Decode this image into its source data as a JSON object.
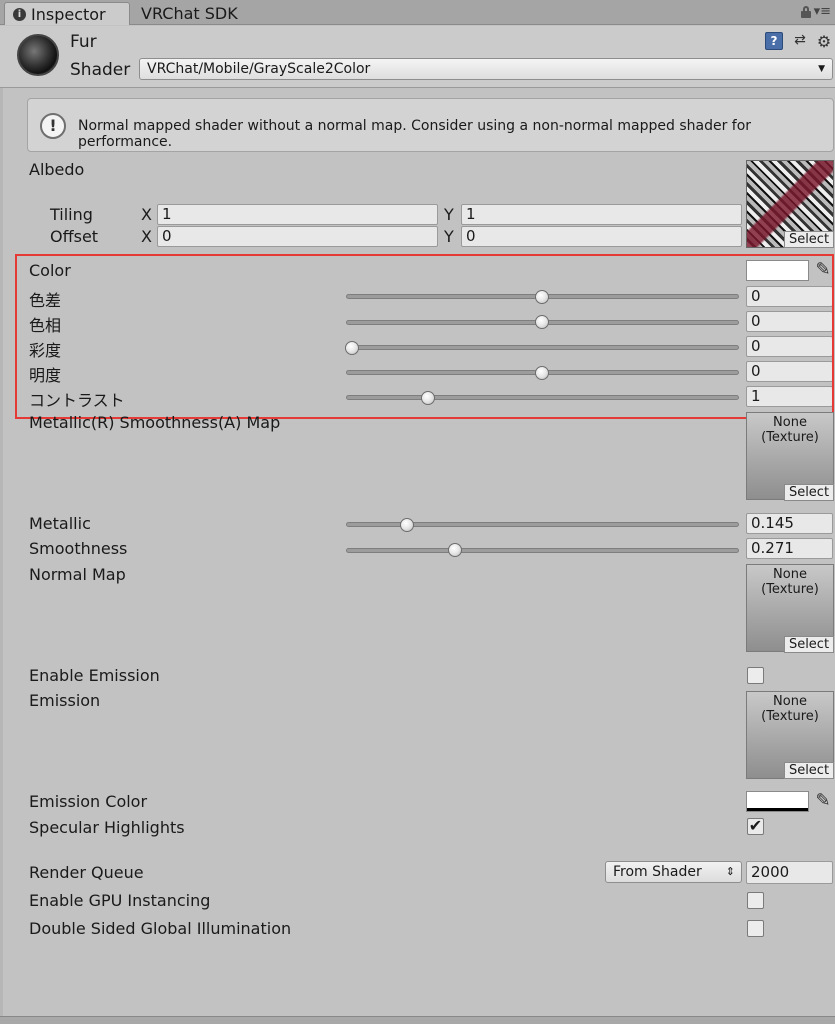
{
  "tabs": [
    {
      "label": "Inspector",
      "active": true,
      "icon": "info-icon"
    },
    {
      "label": "VRChat SDK",
      "active": false
    }
  ],
  "header": {
    "material_name": "Fur",
    "shader_label": "Shader",
    "shader_value": "VRChat/Mobile/GrayScale2Color",
    "icons": [
      "help-icon",
      "preset-icon",
      "gear-icon"
    ]
  },
  "warning": {
    "text": "Normal mapped shader without a normal map. Consider using a non-normal mapped shader for performance."
  },
  "albedo": {
    "label": "Albedo",
    "tiling_label": "Tiling",
    "offset_label": "Offset",
    "x_label": "X",
    "y_label": "Y",
    "tiling_x": "1",
    "tiling_y": "1",
    "offset_x": "0",
    "offset_y": "0",
    "select_label": "Select"
  },
  "color_section": {
    "color_label": "Color",
    "color_value": "#ffffff",
    "sliders": [
      {
        "label": "色差",
        "value": "0",
        "fraction": 0.5
      },
      {
        "label": "色相",
        "value": "0",
        "fraction": 0.5
      },
      {
        "label": "彩度",
        "value": "0",
        "fraction": 0.0
      },
      {
        "label": "明度",
        "value": "0",
        "fraction": 0.5
      },
      {
        "label": "コントラスト",
        "value": "1",
        "fraction": 0.2
      }
    ]
  },
  "metallic_map": {
    "label": "Metallic(R) Smoothness(A) Map",
    "none_text": "None\n(Texture)",
    "none_line1": "None",
    "none_line2": "(Texture)",
    "select_label": "Select"
  },
  "metallic": {
    "label": "Metallic",
    "value": "0.145",
    "fraction": 0.145
  },
  "smoothness": {
    "label": "Smoothness",
    "value": "0.271",
    "fraction": 0.271
  },
  "normal_map": {
    "label": "Normal Map",
    "none_line1": "None",
    "none_line2": "(Texture)",
    "select_label": "Select"
  },
  "emission": {
    "enable_label": "Enable Emission",
    "enabled": false,
    "label": "Emission",
    "none_line1": "None",
    "none_line2": "(Texture)",
    "select_label": "Select",
    "color_label": "Emission Color",
    "color_value": "#ffffff"
  },
  "specular": {
    "label": "Specular Highlights",
    "checked": true
  },
  "render_queue": {
    "label": "Render Queue",
    "dropdown": "From Shader",
    "value": "2000"
  },
  "gpu_instancing": {
    "label": "Enable GPU Instancing",
    "checked": false
  },
  "double_sided_gi": {
    "label": "Double Sided Global Illumination",
    "checked": false
  },
  "colors": {
    "highlight_border": "#e53935",
    "panel_bg": "#c2c2c2"
  }
}
